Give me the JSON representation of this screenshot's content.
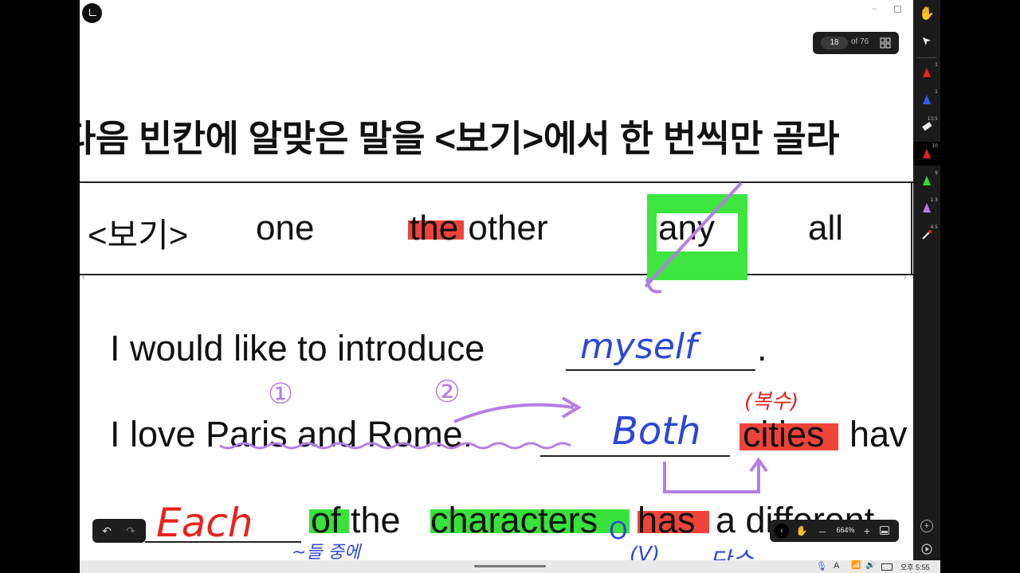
{
  "page_indicator": {
    "current": "18",
    "total_label": "of 76"
  },
  "slide": {
    "heading": "다음 빈칸에 알맞은 말을 <보기>에서 한 번씩만 골라",
    "box_label": "<보기>",
    "options": [
      "one",
      "the other",
      "any",
      "all"
    ],
    "sentence1": {
      "text": "I would like to introduce",
      "end": ".",
      "answer": "myself"
    },
    "sentence2": {
      "text": "I love Paris and Rome.",
      "answer": "Both",
      "tail_word": "cities",
      "tail_rest": "hav",
      "note": "(복수)",
      "marks": [
        "①",
        "②"
      ]
    },
    "sentence3": {
      "answer": "Each",
      "word1": "of the",
      "word2": "characters",
      "word3": "has",
      "rest": "a different",
      "note": "~들 중에",
      "marks": [
        "O",
        "(V)"
      ],
      "partial": "단수"
    }
  },
  "toolbar": {
    "tools": [
      {
        "name": "hand-tool-icon",
        "num": ""
      },
      {
        "name": "select-arrow-icon",
        "num": ""
      },
      {
        "name": "pen-red-icon",
        "num": "1",
        "color": "#e8231c"
      },
      {
        "name": "pen-blue-icon",
        "num": "1",
        "color": "#3a5bea"
      },
      {
        "name": "eraser-icon",
        "num": "13.5"
      },
      {
        "name": "pen-red-active-icon",
        "num": "10",
        "color": "#e8231c"
      },
      {
        "name": "highlighter-green-icon",
        "num": "9",
        "color": "#3bd43b"
      },
      {
        "name": "highlighter-purple-icon",
        "num": "1.3",
        "color": "#b07de8"
      },
      {
        "name": "laser-pointer-icon",
        "num": "4.5"
      }
    ]
  },
  "zoom": {
    "value": "664%"
  },
  "taskbar": {
    "ime": "A",
    "time_label": "오후 5:55"
  }
}
